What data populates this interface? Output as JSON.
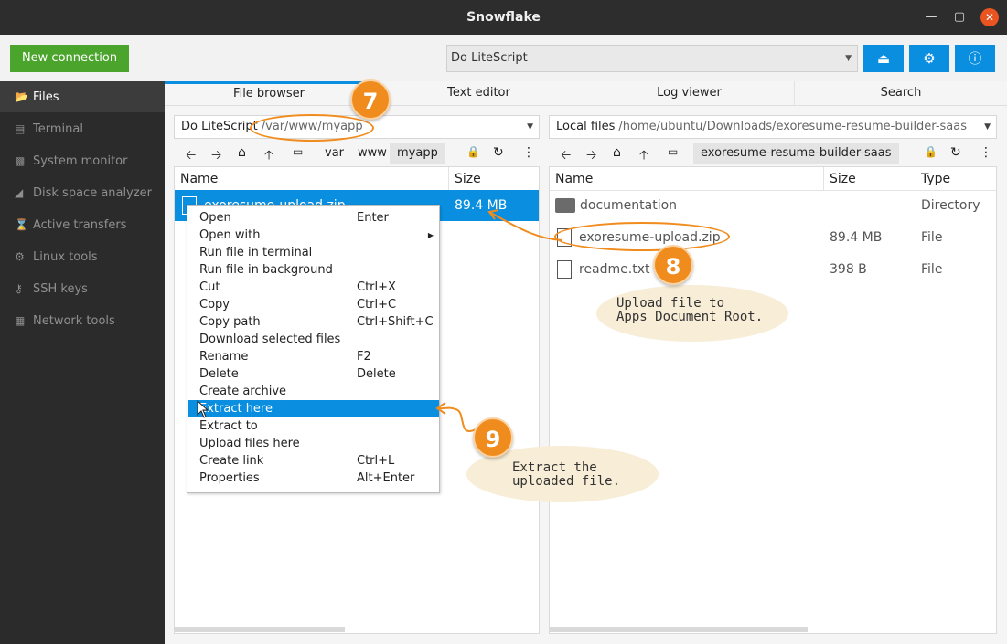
{
  "window": {
    "title": "Snowflake"
  },
  "toolbar": {
    "new_connection": "New connection",
    "session": "Do LiteScript",
    "accent": "#0a8fe0",
    "new_color": "#4ba42c"
  },
  "sidebar": {
    "items": [
      {
        "label": "Files",
        "icon": "folder-open-icon"
      },
      {
        "label": "Terminal",
        "icon": "terminal-icon"
      },
      {
        "label": "System monitor",
        "icon": "bar-chart-icon"
      },
      {
        "label": "Disk space analyzer",
        "icon": "area-chart-icon"
      },
      {
        "label": "Active transfers",
        "icon": "hourglass-icon"
      },
      {
        "label": "Linux tools",
        "icon": "cogs-icon"
      },
      {
        "label": "SSH keys",
        "icon": "key-icon"
      },
      {
        "label": "Network tools",
        "icon": "briefcase-icon"
      }
    ]
  },
  "tabs": [
    "File browser",
    "Text editor",
    "Log viewer",
    "Search"
  ],
  "left": {
    "host": "Do LiteScript",
    "path": "/var/www/myapp",
    "crumbs": [
      "var",
      "www",
      "myapp"
    ],
    "columns": {
      "name": "Name",
      "size": "Size"
    },
    "rows": [
      {
        "name": "exoresume-upload.zip",
        "size": "89.4 MB"
      }
    ]
  },
  "right": {
    "host": "Local files",
    "path": "/home/ubuntu/Downloads/exoresume-resume-builder-saas",
    "crumb": "exoresume-resume-builder-saas",
    "columns": {
      "name": "Name",
      "size": "Size",
      "type": "Type"
    },
    "rows": [
      {
        "name": "documentation",
        "size": "",
        "type": "Directory"
      },
      {
        "name": "exoresume-upload.zip",
        "size": "89.4 MB",
        "type": "File"
      },
      {
        "name": "readme.txt",
        "size": "398 B",
        "type": "File"
      }
    ]
  },
  "menu": {
    "items": [
      {
        "label": "Open",
        "shortcut": "Enter"
      },
      {
        "label": "Open with",
        "shortcut": ""
      },
      {
        "label": "Run file in terminal",
        "shortcut": ""
      },
      {
        "label": "Run file in background",
        "shortcut": ""
      },
      {
        "label": "Cut",
        "shortcut": "Ctrl+X"
      },
      {
        "label": "Copy",
        "shortcut": "Ctrl+C"
      },
      {
        "label": "Copy path",
        "shortcut": "Ctrl+Shift+C"
      },
      {
        "label": "Download selected files",
        "shortcut": ""
      },
      {
        "label": "Rename",
        "shortcut": "F2"
      },
      {
        "label": "Delete",
        "shortcut": "Delete"
      },
      {
        "label": "Create archive",
        "shortcut": ""
      },
      {
        "label": "Extract here",
        "shortcut": ""
      },
      {
        "label": "Extract to",
        "shortcut": ""
      },
      {
        "label": "Upload files here",
        "shortcut": ""
      },
      {
        "label": "Create link",
        "shortcut": "Ctrl+L"
      },
      {
        "label": "Properties",
        "shortcut": "Alt+Enter"
      }
    ]
  },
  "annotations": {
    "step7": "7",
    "step8": "8",
    "step9": "9",
    "note8_line1": "Upload file to",
    "note8_line2": "Apps Document Root.",
    "note9_line1": "Extract the",
    "note9_line2": "uploaded file.",
    "color": "#f08c1e"
  }
}
